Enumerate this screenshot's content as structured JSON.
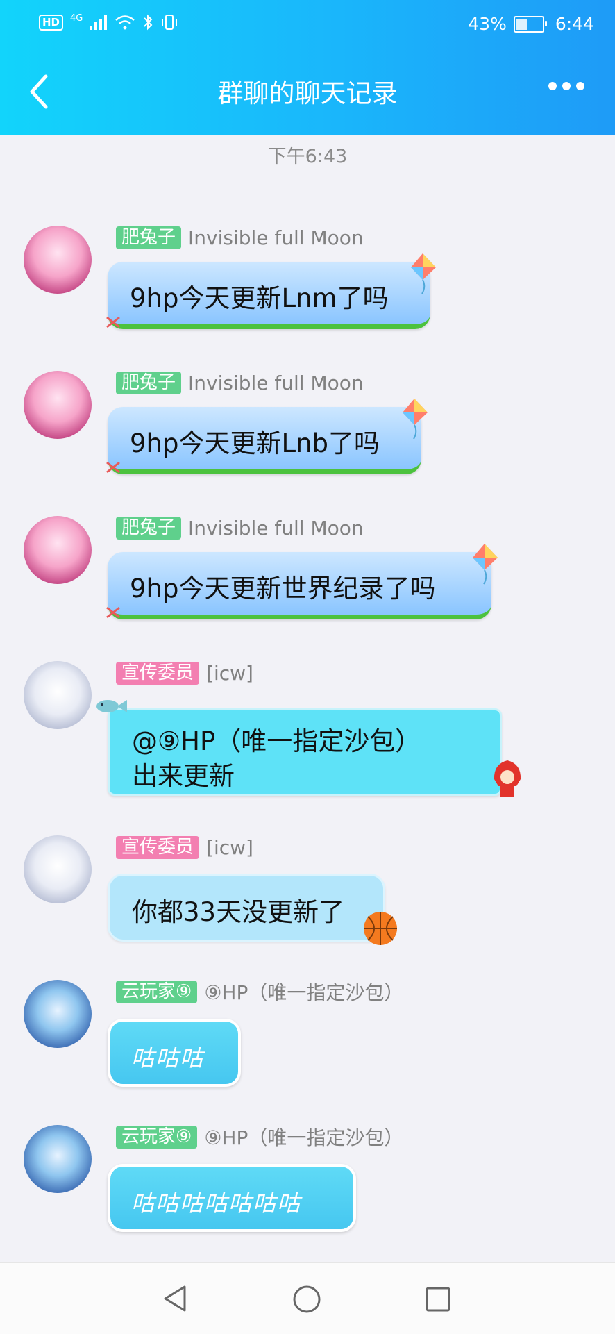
{
  "status_bar": {
    "network": "4G",
    "hd": "HD",
    "battery": "43%",
    "battery_level": 43,
    "time": "6:44"
  },
  "nav": {
    "title": "群聊的聊天记录",
    "back_icon": "chevron-left-icon",
    "more_icon": "more-icon"
  },
  "time_divider": "下午6:43",
  "messages": [
    {
      "tag": "肥兔子",
      "nick": "Invisible full Moon",
      "text": "9hp今天更新Lnm了吗"
    },
    {
      "tag": "肥兔子",
      "nick": "Invisible full Moon",
      "text": "9hp今天更新Lnb了吗"
    },
    {
      "tag": "肥兔子",
      "nick": "Invisible full Moon",
      "text": "9hp今天更新世界纪录了吗"
    },
    {
      "tag": "宣传委员",
      "nick": "[icw]",
      "text_line1": "@⑨HP（唯一指定沙包）",
      "text_line2": "出来更新"
    },
    {
      "tag": "宣传委员",
      "nick": "[icw]",
      "text": "你都33天没更新了"
    },
    {
      "tag": "云玩家⑨",
      "nick": "⑨HP（唯一指定沙包）",
      "text": "咕咕咕"
    },
    {
      "tag": "云玩家⑨",
      "nick": "⑨HP（唯一指定沙包）",
      "text": "咕咕咕咕咕咕咕"
    }
  ],
  "colors": {
    "header_start": "#12d4fb",
    "header_end": "#1e9bf7",
    "tag_green": "#5fd08c",
    "tag_pink": "#f37fb1"
  }
}
